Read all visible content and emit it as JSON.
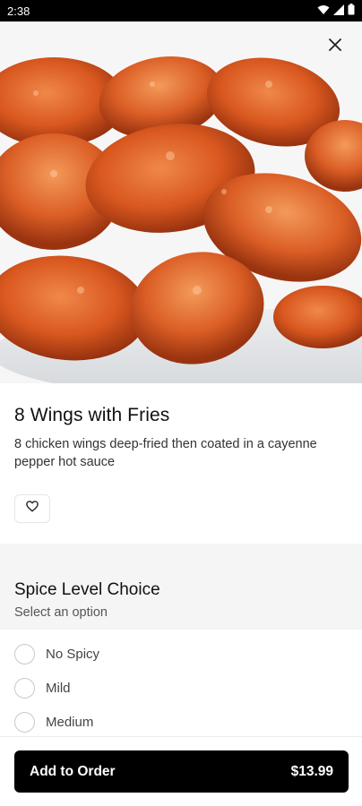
{
  "status_bar": {
    "time": "2:38"
  },
  "item": {
    "title": "8 Wings with Fries",
    "description": "8 chicken wings deep-fried then coated in a cayenne pepper hot sauce"
  },
  "options_section": {
    "title": "Spice Level Choice",
    "subtitle": "Select an option",
    "options": [
      "No Spicy",
      "Mild",
      "Medium"
    ]
  },
  "footer": {
    "button_label": "Add to Order",
    "price": "$13.99"
  },
  "colors": {
    "primary_button": "#000000",
    "section_background": "#f5f5f5"
  },
  "icons": [
    "wifi-icon",
    "signal-icon",
    "battery-icon",
    "close-icon",
    "heart-icon"
  ]
}
